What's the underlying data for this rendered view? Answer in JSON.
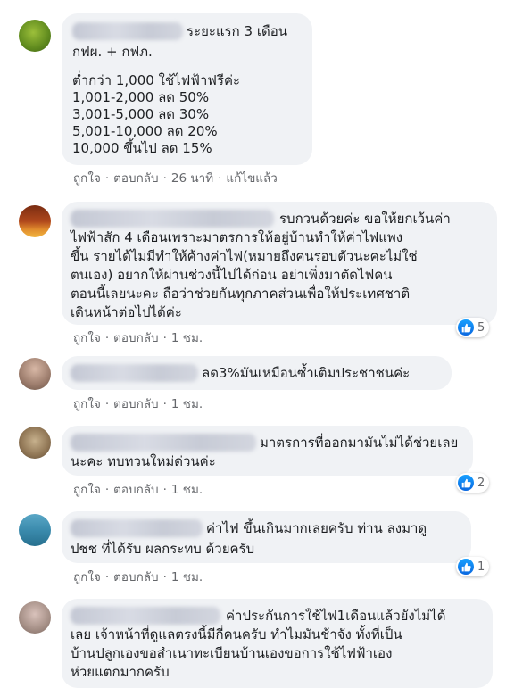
{
  "colors": {
    "bubble": "#f0f2f5",
    "meta": "#65676b",
    "like": "#1877f2"
  },
  "icons": {
    "reaction": "like-icon"
  },
  "comments": [
    {
      "lines": [
        "ระยะแรก 3 เดือน",
        "กฟผ. + กฟภ.",
        "",
        "ต่ำกว่า 1,000 ใช้ไฟฟ้าฟรีค่ะ",
        "1,001-2,000 ลด 50%",
        "3,001-5,000 ลด 30%",
        "5,001-10,000 ลด 20%",
        "10,000 ขึ้นไป ลด 15%"
      ],
      "like": "ถูกใจ",
      "reply": "ตอบกลับ",
      "time": "26 นาที",
      "edited": "แก้ไขแล้ว"
    },
    {
      "lines": [
        "รบกวนด้วยค่ะ ขอให้ยกเว้นค่า",
        "ไฟฟ้าสัก 4 เดือนเพราะมาตรการให้อยู่บ้านทำให้ค่าไฟแพง",
        "ขึ้น รายได้ไม่มีทำให้ค้างค่าไฟ(หมายถึงคนรอบตัวนะคะไม่ใช่",
        "ตนเอง) อยากให้ผ่านช่วงนี้ไปได้ก่อน อย่าเพิ่งมาตัดไฟคน",
        "ตอนนี้เลยนะคะ ถือว่าช่วยกันทุกภาคส่วนเพื่อให้ประเทศชาติ",
        "เดินหน้าต่อไปได้ค่ะ"
      ],
      "like": "ถูกใจ",
      "reply": "ตอบกลับ",
      "time": "1 ชม.",
      "reactions": "5"
    },
    {
      "lines": [
        "ลด3%มันเหมือนซ้ำเติมประชาชนค่ะ"
      ],
      "like": "ถูกใจ",
      "reply": "ตอบกลับ",
      "time": "1 ชม."
    },
    {
      "lines": [
        "มาตรการที่ออกมามันไม่ได้ช่วยเลย",
        "นะคะ ทบทวนใหม่ด่วนค่ะ"
      ],
      "like": "ถูกใจ",
      "reply": "ตอบกลับ",
      "time": "1 ชม.",
      "reactions": "2"
    },
    {
      "lines": [
        "ค่าไฟ ขึ้นเกินมากเลยครับ ท่าน ลงมาดู",
        "ปชช ที่ได้รับ ผลกระทบ ด้วยครับ"
      ],
      "like": "ถูกใจ",
      "reply": "ตอบกลับ",
      "time": "1 ชม.",
      "reactions": "1"
    },
    {
      "lines": [
        "ค่าประกันการใช้ไฟ1เดือนแล้วยังไม่ได้",
        "เลย เจ้าหน้าที่ดูแลตรงนี้มีกี่คนครับ ทำไมมันช้าจัง ทั้งที่เป็น",
        "บ้านปลูกเองขอสำเนาทะเบียนบ้านเองขอการใช้ไฟฟ้าเอง",
        "ห่วยแตกมากครับ"
      ]
    }
  ]
}
